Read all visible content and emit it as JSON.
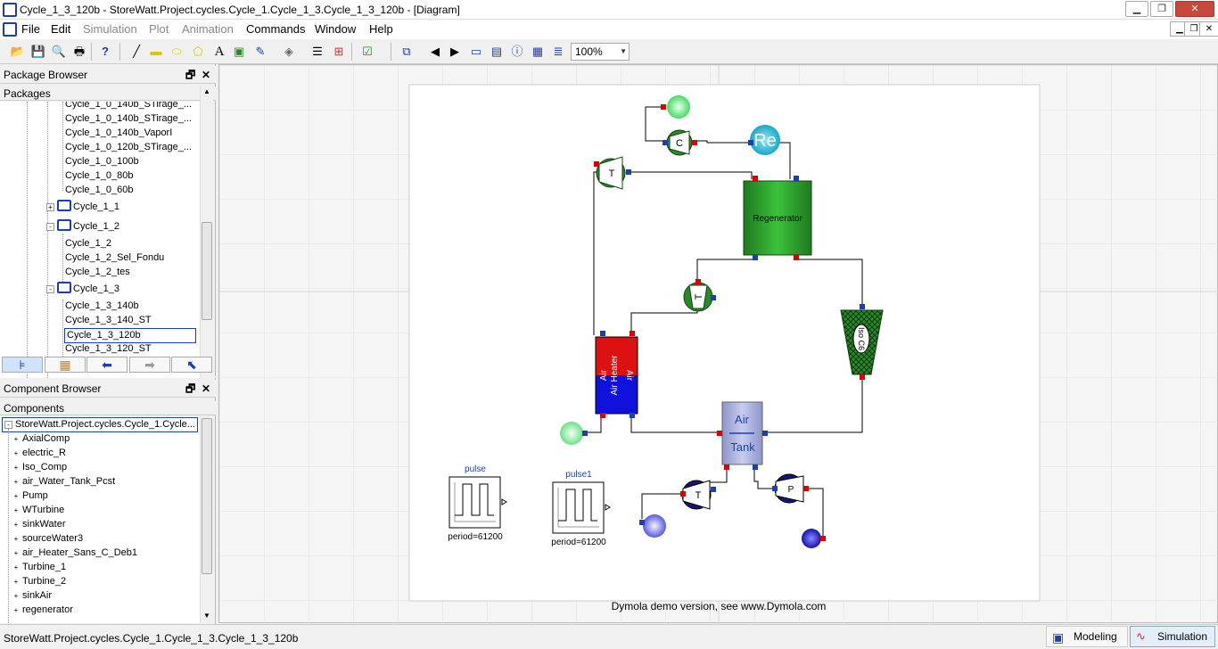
{
  "window": {
    "title": "Cycle_1_3_120b - StoreWatt.Project.cycles.Cycle_1.Cycle_1_3.Cycle_1_3_120b  - [Diagram]"
  },
  "menu": {
    "items": [
      "File",
      "Edit",
      "Simulation",
      "Plot",
      "Animation",
      "Commands",
      "Window",
      "Help"
    ],
    "disabled": [
      "Simulation",
      "Plot",
      "Animation"
    ]
  },
  "toolbar": {
    "zoom": "100%"
  },
  "package_browser": {
    "title": "Package Browser",
    "header": "Packages",
    "items": [
      {
        "label": "Cycle_1_0_140b_STirage_...",
        "level": 2,
        "partial": true
      },
      {
        "label": "Cycle_1_0_140b_STirage_...",
        "level": 2
      },
      {
        "label": "Cycle_1_0_140b_VaporI",
        "level": 2
      },
      {
        "label": "Cycle_1_0_120b_STirage_...",
        "level": 2
      },
      {
        "label": "Cycle_1_0_100b",
        "level": 2
      },
      {
        "label": "Cycle_1_0_80b",
        "level": 2
      },
      {
        "label": "Cycle_1_0_60b",
        "level": 2
      },
      {
        "label": "Cycle_1_1",
        "level": 1,
        "package": true,
        "expander": "+"
      },
      {
        "label": "Cycle_1_2",
        "level": 1,
        "package": true,
        "expander": "-"
      },
      {
        "label": "Cycle_1_2",
        "level": 2
      },
      {
        "label": "Cycle_1_2_Sel_Fondu",
        "level": 2
      },
      {
        "label": "Cycle_1_2_tes",
        "level": 2
      },
      {
        "label": "Cycle_1_3",
        "level": 1,
        "package": true,
        "expander": "-"
      },
      {
        "label": "Cycle_1_3_140b",
        "level": 2
      },
      {
        "label": "Cycle_1_3_140_ST",
        "level": 2
      },
      {
        "label": "Cycle_1_3_120b",
        "level": 2,
        "selected": true
      },
      {
        "label": "Cycle_1_3_120_ST",
        "level": 2
      }
    ]
  },
  "component_browser": {
    "title": "Component Browser",
    "header": "Components",
    "root": "StoreWatt.Project.cycles.Cycle_1.Cycle...",
    "items": [
      "AxialComp",
      "electric_R",
      "Iso_Comp",
      "air_Water_Tank_Pcst",
      "Pump",
      "WTurbine",
      "sinkWater",
      "sourceWater3",
      "air_Heater_Sans_C_Deb1",
      "Turbine_1",
      "Turbine_2",
      "sinkAir",
      "regenerator"
    ]
  },
  "diagram": {
    "regenerator_label": "Regenerator",
    "compressor_label": "C",
    "turbine_label": "T",
    "re_label": "Re",
    "pump_label": "P",
    "air_heater_left": "Air",
    "air_heater_mid": "Air Heater",
    "air_heater_right": "Air",
    "iso_comp_label": "Iso C6",
    "tank_top": "Air",
    "tank_bottom": "Tank",
    "pulse_name": "pulse",
    "pulse_param": "period=61200",
    "pulse1_name": "pulse1",
    "pulse1_param": "period=61200",
    "watermark": "Dymola demo version, see www.Dymola.com"
  },
  "status": {
    "path": "StoreWatt.Project.cycles.Cycle_1.Cycle_1_3.Cycle_1_3_120b",
    "modeling": "Modeling",
    "simulation": "Simulation"
  }
}
